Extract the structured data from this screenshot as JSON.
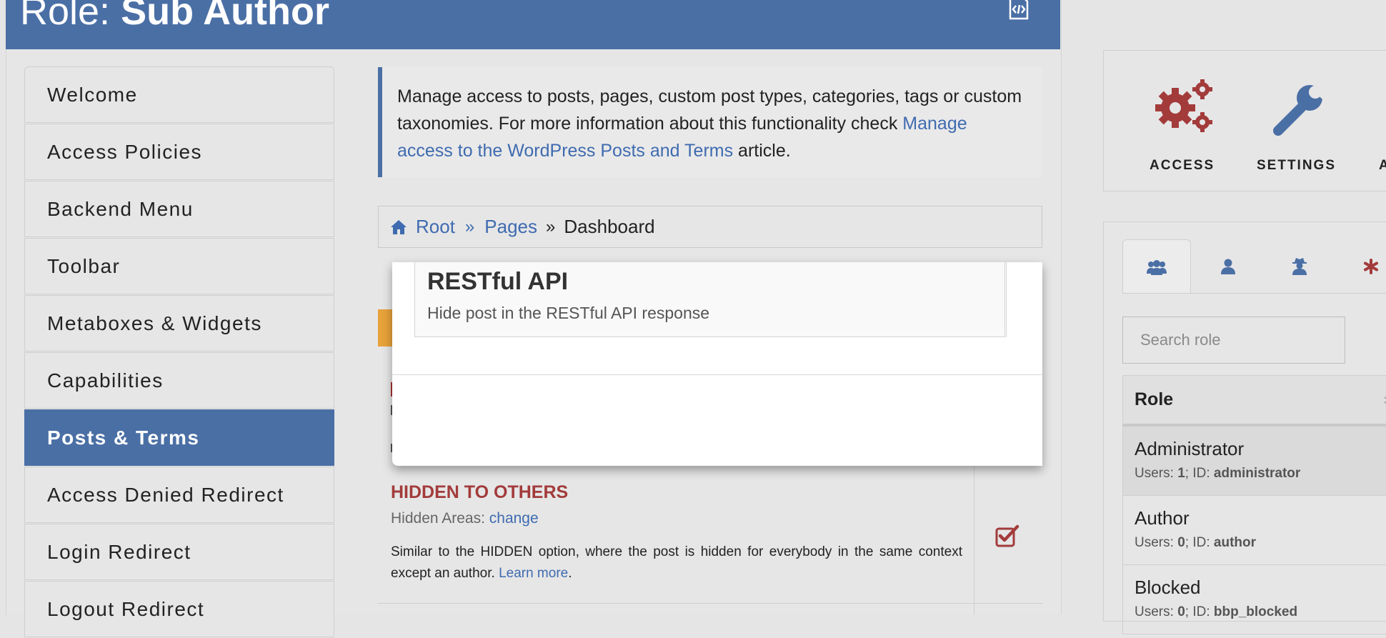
{
  "header": {
    "title_prefix": "Role: ",
    "title_role": "Sub Author",
    "code_icon": "file-code-icon"
  },
  "sidebar": {
    "items": [
      {
        "label": "Welcome"
      },
      {
        "label": "Access Policies"
      },
      {
        "label": "Backend Menu"
      },
      {
        "label": "Toolbar"
      },
      {
        "label": "Metaboxes & Widgets"
      },
      {
        "label": "Capabilities"
      },
      {
        "label": "Posts & Terms",
        "active": true
      },
      {
        "label": "Access Denied Redirect"
      },
      {
        "label": "Login Redirect"
      },
      {
        "label": "Logout Redirect"
      }
    ]
  },
  "info": {
    "text_before": "Manage access to posts, pages, custom post types, categories, tags or custom taxonomies. For more information about this functionality check ",
    "link": "Manage access to the WordPress Posts and Terms",
    "text_after": " article."
  },
  "breadcrumb": {
    "home_icon": "home-icon",
    "root": "Root",
    "sep1": "»",
    "pages": "Pages",
    "sep2": "»",
    "current": "Dashboard"
  },
  "modal": {
    "option_title": "RESTful API",
    "option_desc": "Hide post in the RESTful API response"
  },
  "hidden_option": {
    "title": "HIDDEN TO OTHERS",
    "areas_label": "Hidden Areas: ",
    "areas_link": "change",
    "desc": "Similar to the HIDDEN option, where the post is hidden for everybody in the same context except an author. ",
    "learn_more": "Learn more",
    "desc_end": ".",
    "checked": true
  },
  "icon_panel": {
    "items": [
      {
        "label": "ACCESS",
        "icon": "gears-icon",
        "color": "#a33b3b"
      },
      {
        "label": "SETTINGS",
        "icon": "wrench-icon",
        "color": "#4a6fa5"
      },
      {
        "label": "A",
        "icon": "",
        "color": "#222"
      }
    ]
  },
  "role_panel": {
    "tabs": [
      "users-icon",
      "user-icon",
      "user-secret-icon",
      "asterisk-icon"
    ],
    "search_placeholder": "Search role",
    "column_header": "Role",
    "roles": [
      {
        "name": "Administrator",
        "users_label": "Users: ",
        "users": "1",
        "id_label": "; ID: ",
        "id": "administrator"
      },
      {
        "name": "Author",
        "users_label": "Users: ",
        "users": "0",
        "id_label": "; ID: ",
        "id": "author"
      },
      {
        "name": "Blocked",
        "users_label": "Users: ",
        "users": "0",
        "id_label": "; ID: ",
        "id": "bbp_blocked"
      }
    ]
  },
  "colors": {
    "primary": "#4a6fa5",
    "danger": "#a33b3b",
    "warning": "#e8a23a",
    "link": "#3f6bb0"
  }
}
